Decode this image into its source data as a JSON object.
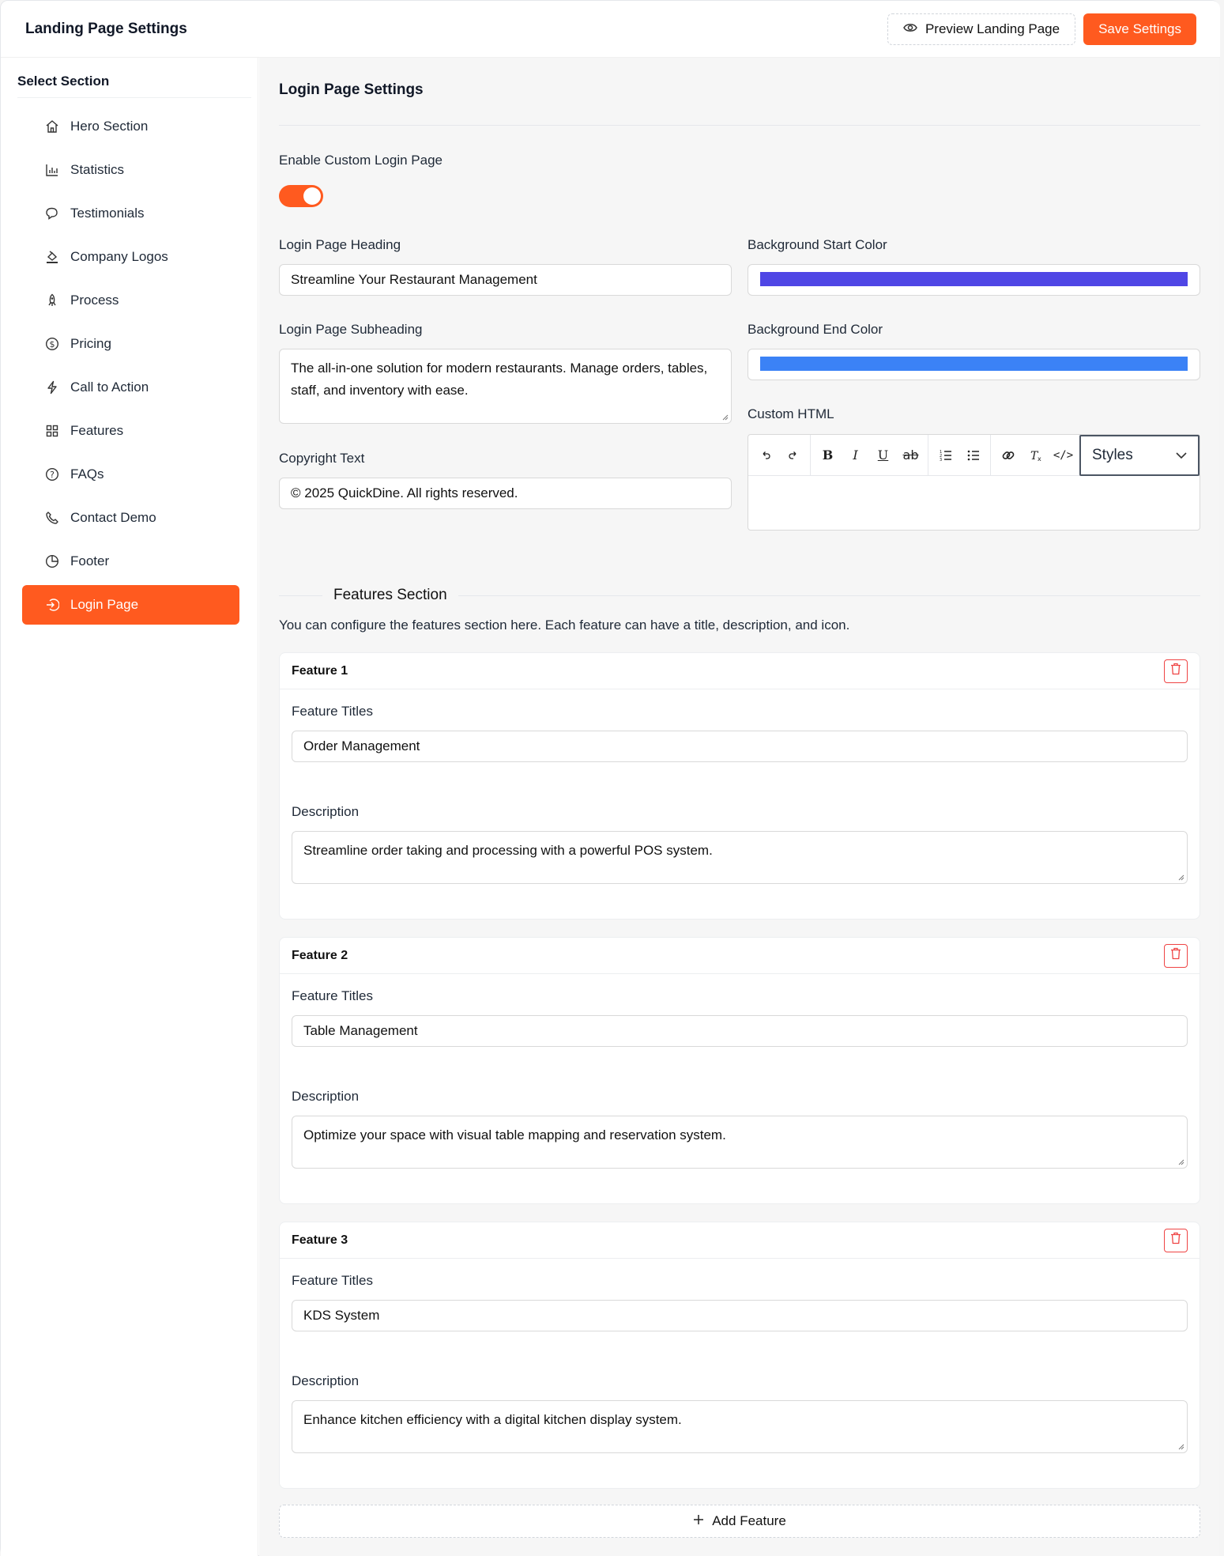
{
  "header": {
    "title": "Landing Page Settings",
    "preview_label": "Preview Landing Page",
    "save_label": "Save Settings"
  },
  "sidebar": {
    "title": "Select Section",
    "items": [
      {
        "label": "Hero Section",
        "icon": "home-icon"
      },
      {
        "label": "Statistics",
        "icon": "bar-chart-icon"
      },
      {
        "label": "Testimonials",
        "icon": "chat-bubbles-icon"
      },
      {
        "label": "Company Logos",
        "icon": "paint-bucket-icon"
      },
      {
        "label": "Process",
        "icon": "rocket-icon"
      },
      {
        "label": "Pricing",
        "icon": "dollar-circle-icon"
      },
      {
        "label": "Call to Action",
        "icon": "lightning-icon"
      },
      {
        "label": "Features",
        "icon": "grid-icon"
      },
      {
        "label": "FAQs",
        "icon": "question-circle-icon"
      },
      {
        "label": "Contact Demo",
        "icon": "phone-icon"
      },
      {
        "label": "Footer",
        "icon": "pie-chart-icon"
      },
      {
        "label": "Login Page",
        "icon": "login-icon",
        "active": true
      }
    ]
  },
  "main": {
    "heading": "Login Page Settings",
    "enable_label": "Enable Custom Login Page",
    "enable_value": true,
    "heading_label": "Login Page Heading",
    "heading_value": "Streamline Your Restaurant Management",
    "subheading_label": "Login Page Subheading",
    "subheading_value": "The all-in-one solution for modern restaurants. Manage orders, tables, staff, and inventory with ease.",
    "copyright_label": "Copyright Text",
    "copyright_value": "© 2025 QuickDine. All rights reserved.",
    "bg_start_label": "Background Start Color",
    "bg_start_color": "#4f46e5",
    "bg_end_label": "Background End Color",
    "bg_end_color": "#3b82f6",
    "custom_html_label": "Custom HTML",
    "editor": {
      "styles_label": "Styles"
    }
  },
  "features": {
    "section_title": "Features Section",
    "description": "You can configure the features section here. Each feature can have a title, description, and icon.",
    "title_label": "Feature Titles",
    "description_label": "Description",
    "items": [
      {
        "name": "Feature 1",
        "title": "Order Management",
        "description": "Streamline order taking and processing with a powerful POS system."
      },
      {
        "name": "Feature 2",
        "title": "Table Management",
        "description": "Optimize your space with visual table mapping and reservation system."
      },
      {
        "name": "Feature 3",
        "title": "KDS System",
        "description": "Enhance kitchen efficiency with a digital kitchen display system."
      }
    ],
    "add_label": "Add Feature"
  },
  "colors": {
    "accent": "#ff5a1f",
    "danger": "#ef4444"
  }
}
